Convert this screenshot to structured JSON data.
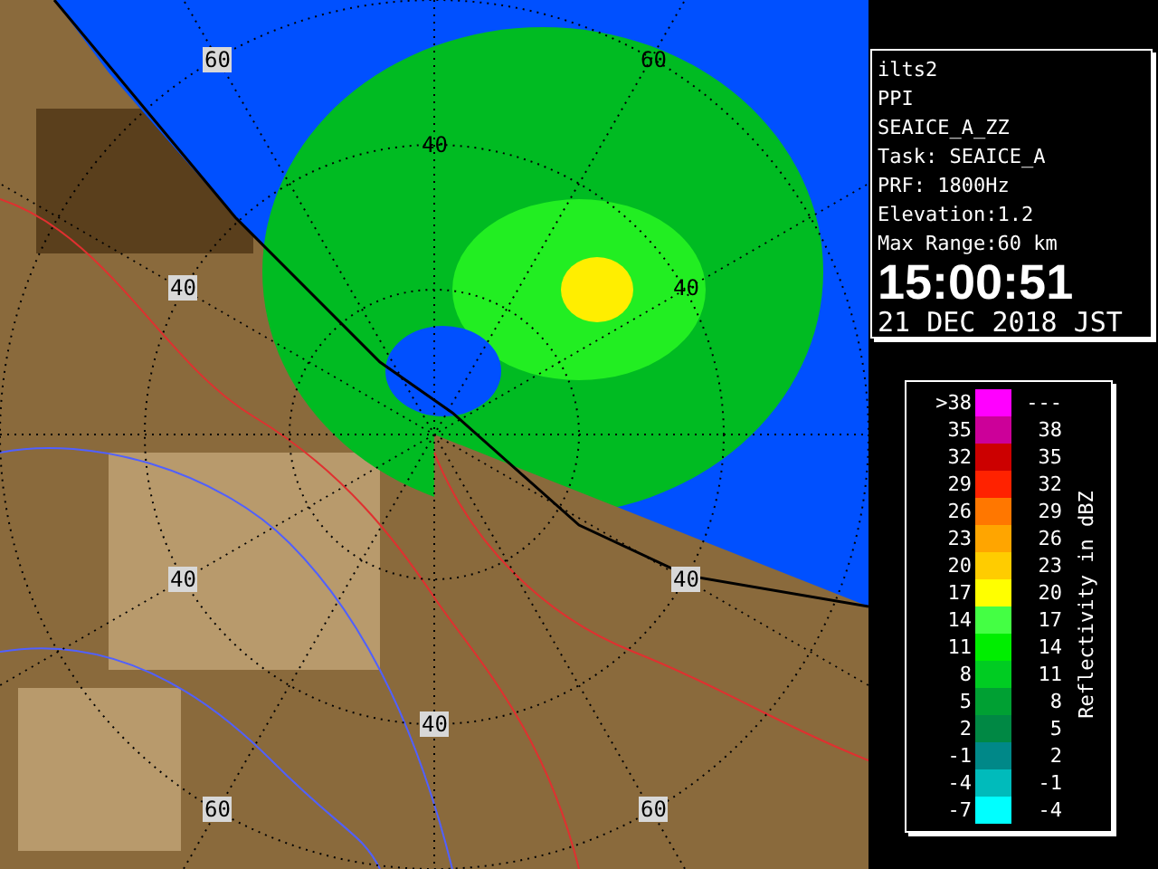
{
  "radar_map": {
    "range_labels": [
      {
        "text": "60",
        "boxed": true
      },
      {
        "text": "60",
        "boxed": false
      },
      {
        "text": "40",
        "boxed": false
      },
      {
        "text": "40",
        "boxed": true
      },
      {
        "text": "40",
        "boxed": false
      },
      {
        "text": "40",
        "boxed": true
      },
      {
        "text": "40",
        "boxed": true
      },
      {
        "text": "40",
        "boxed": true
      },
      {
        "text": "60",
        "boxed": true
      },
      {
        "text": "60",
        "boxed": true
      }
    ]
  },
  "info_panel": {
    "lines": [
      "ilts2",
      "PPI",
      "SEAICE_A_ZZ",
      "Task: SEAICE_A",
      "PRF: 1800Hz",
      "Elevation:1.2",
      "Max Range:60 km"
    ],
    "time": "15:00:51",
    "date": "21 DEC 2018 JST"
  },
  "legend": {
    "title": "Reflectivity in dBZ",
    "rows": [
      {
        "low": ">38",
        "high": "---",
        "color": "#ff00ff"
      },
      {
        "low": "35",
        "high": "38",
        "color": "#cc0099"
      },
      {
        "low": "32",
        "high": "35",
        "color": "#cc0000"
      },
      {
        "low": "29",
        "high": "32",
        "color": "#ff2200"
      },
      {
        "low": "26",
        "high": "29",
        "color": "#ff7700"
      },
      {
        "low": "23",
        "high": "26",
        "color": "#ffa500"
      },
      {
        "low": "20",
        "high": "23",
        "color": "#ffcc00"
      },
      {
        "low": "17",
        "high": "20",
        "color": "#ffff00"
      },
      {
        "low": "14",
        "high": "17",
        "color": "#44ff44"
      },
      {
        "low": "11",
        "high": "14",
        "color": "#00ee00"
      },
      {
        "low": "8",
        "high": "11",
        "color": "#00cc22"
      },
      {
        "low": "5",
        "high": "8",
        "color": "#00a033"
      },
      {
        "low": "2",
        "high": "5",
        "color": "#008844"
      },
      {
        "low": "-1",
        "high": "2",
        "color": "#008888"
      },
      {
        "low": "-4",
        "high": "-1",
        "color": "#00bbbb"
      },
      {
        "low": "-7",
        "high": "-4",
        "color": "#00ffff"
      }
    ]
  }
}
